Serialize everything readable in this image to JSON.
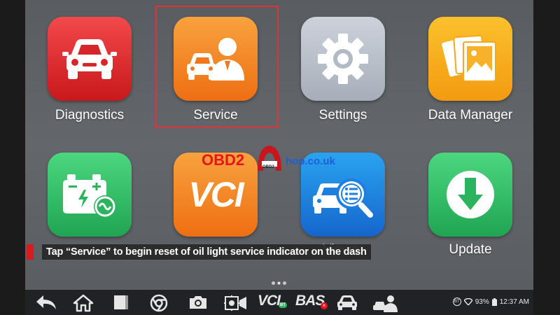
{
  "apps": [
    {
      "id": "diagnostics",
      "label": "Diagnostics",
      "icon": "car-front-icon"
    },
    {
      "id": "service",
      "label": "Service",
      "icon": "mechanic-car-icon"
    },
    {
      "id": "settings",
      "label": "Settings",
      "icon": "gear-icon"
    },
    {
      "id": "data-manager",
      "label": "Data Manager",
      "icon": "photos-icon"
    },
    {
      "id": "battery",
      "label": "",
      "icon": "battery-test-icon"
    },
    {
      "id": "vci",
      "label": "",
      "icon": "vci-icon"
    },
    {
      "id": "viewer",
      "label": "Viewer",
      "icon": "car-search-icon"
    },
    {
      "id": "update",
      "label": "Update",
      "icon": "download-icon"
    }
  ],
  "watermark": {
    "brand": "OBD2",
    "suffix": "hop.co.uk",
    "badge": "OBD2"
  },
  "caption": "Tap “Service” to begin reset of oil light service indicator on the dash",
  "vci_text": "VCI",
  "taskbar": {
    "vci_label": "VCI",
    "vci_badge": "BT",
    "bas_label": "BAS",
    "battery_percent": "93%",
    "time": "12:37 AM",
    "bt_indicator": "BT"
  },
  "colors": {
    "highlight": "#e23333",
    "watermark_red": "#e8141c",
    "watermark_blue": "#1c5fd6"
  }
}
